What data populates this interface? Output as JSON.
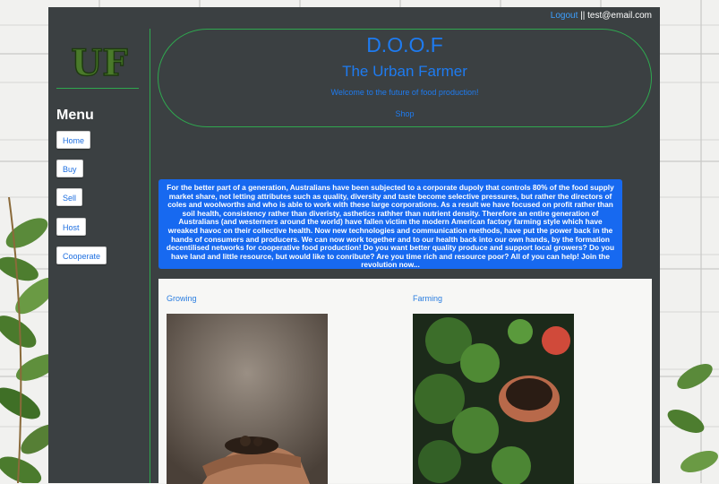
{
  "topbar": {
    "logout_label": "Logout",
    "separator": " || ",
    "email": "test@email.com"
  },
  "sidebar": {
    "logo_text": "UF",
    "menu_title": "Menu",
    "items": [
      {
        "label": "Home"
      },
      {
        "label": "Buy"
      },
      {
        "label": "Sell"
      },
      {
        "label": "Host"
      },
      {
        "label": "Cooperate"
      }
    ]
  },
  "hero": {
    "title": "D.O.O.F",
    "subtitle": "The Urban Farmer",
    "welcome": "Welcome to the future of food production!",
    "shop_link": "Shop"
  },
  "intro": {
    "text": "For the better part of a generation, Australians have been subjected to a corporate dupoly that controls 80% of the food supply market share, not letting attributes such as quality, diversity and taste become selective pressures, but rather the directors of coles and woolworths and who is able to work with these large corporations. As a result we have focused on profit rather than soil health, consistency rather than diveristy, asthetics rathher than nutrient density. Therefore an entire generation of Australians (and westerners around the world) have fallen victim the modern American factory farming style which have wreaked havoc on their collective health. Now new technologies and communication methods, have put the power back in the hands of consumers and producers. We can now work together and to our health back into our own hands, by the formation decentilised networks for cooperative food production! Do you want better quality produce and support local growers? Do you have land and little resource, but would like to conribute? Are you time rich and resource poor? All of you can help! Join the revolution now..."
  },
  "gallery": {
    "cards": [
      {
        "label": "Growing",
        "image": "hands-holding-soil-photo"
      },
      {
        "label": "Farming",
        "image": "potted-herbs-photo"
      }
    ]
  },
  "colors": {
    "accent_blue": "#1e7bf0",
    "border_green": "#2fa84f",
    "frame_bg": "#3b4042"
  }
}
